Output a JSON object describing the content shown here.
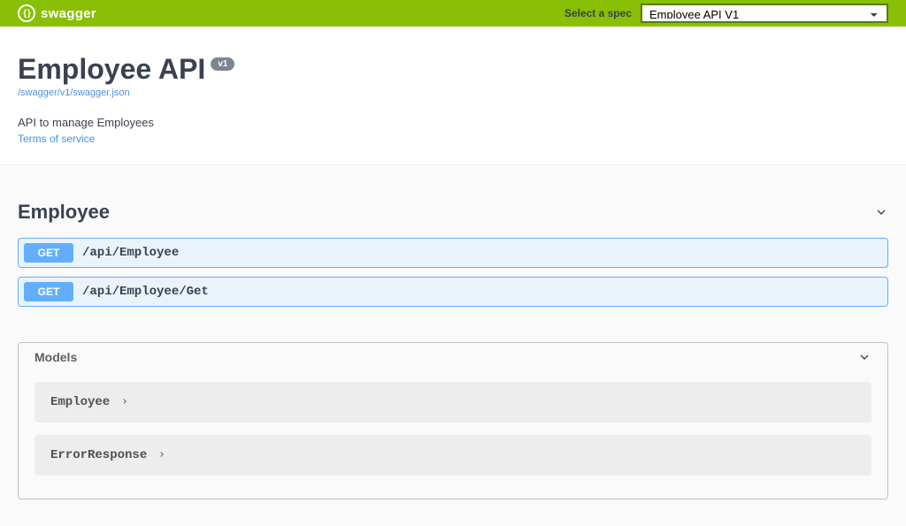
{
  "topbar": {
    "logo_text": "swagger",
    "spec_label": "Select a spec",
    "spec_selected": "Employee API V1"
  },
  "info": {
    "title": "Employee API",
    "version": "v1",
    "spec_url": "/swagger/v1/swagger.json",
    "description": "API to manage Employees",
    "terms_label": "Terms of service"
  },
  "tag": {
    "name": "Employee",
    "ops": [
      {
        "method": "GET",
        "path": "/api/Employee"
      },
      {
        "method": "GET",
        "path": "/api/Employee/Get"
      }
    ]
  },
  "models": {
    "title": "Models",
    "items": [
      {
        "name": "Employee"
      },
      {
        "name": "ErrorResponse"
      }
    ]
  }
}
